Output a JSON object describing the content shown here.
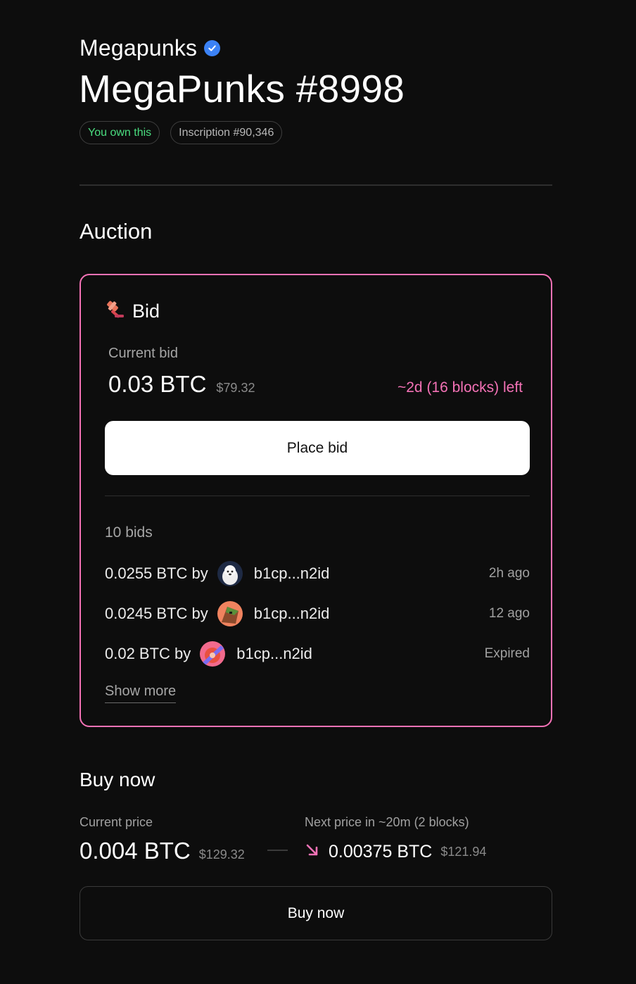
{
  "header": {
    "collection_name": "Megapunks",
    "item_title": "MegaPunks #8998",
    "ownership_badge": "You own this",
    "inscription_badge": "Inscription #90,346"
  },
  "auction": {
    "section_title": "Auction",
    "card_title": "Bid",
    "current_bid_label": "Current bid",
    "current_bid_amount": "0.03 BTC",
    "current_bid_usd": "$79.32",
    "time_left": "~2d (16 blocks) left",
    "place_bid_label": "Place bid",
    "bids_count": "10 bids",
    "bids": [
      {
        "amount": "0.0255 BTC by",
        "address": "b1cp...n2id",
        "time": "2h ago",
        "avatar": "dog-avatar"
      },
      {
        "amount": "0.0245 BTC by",
        "address": "b1cp...n2id",
        "time": "12 ago",
        "avatar": "punk-avatar"
      },
      {
        "amount": "0.02 BTC by",
        "address": "b1cp...n2id",
        "time": "Expired",
        "avatar": "pink-avatar"
      }
    ],
    "show_more_label": "Show more"
  },
  "buy_now": {
    "section_title": "Buy now",
    "current_price_label": "Current price",
    "current_price": "0.004 BTC",
    "current_price_usd": "$129.32",
    "next_price_label": "Next price in ~20m (2 blocks)",
    "next_price": "0.00375 BTC",
    "next_price_usd": "$121.94",
    "buy_button_label": "Buy now"
  },
  "colors": {
    "accent_pink": "#f472b6",
    "owned_green": "#4ade80",
    "verified_blue": "#3b82f6",
    "background": "#0d0d0d"
  }
}
